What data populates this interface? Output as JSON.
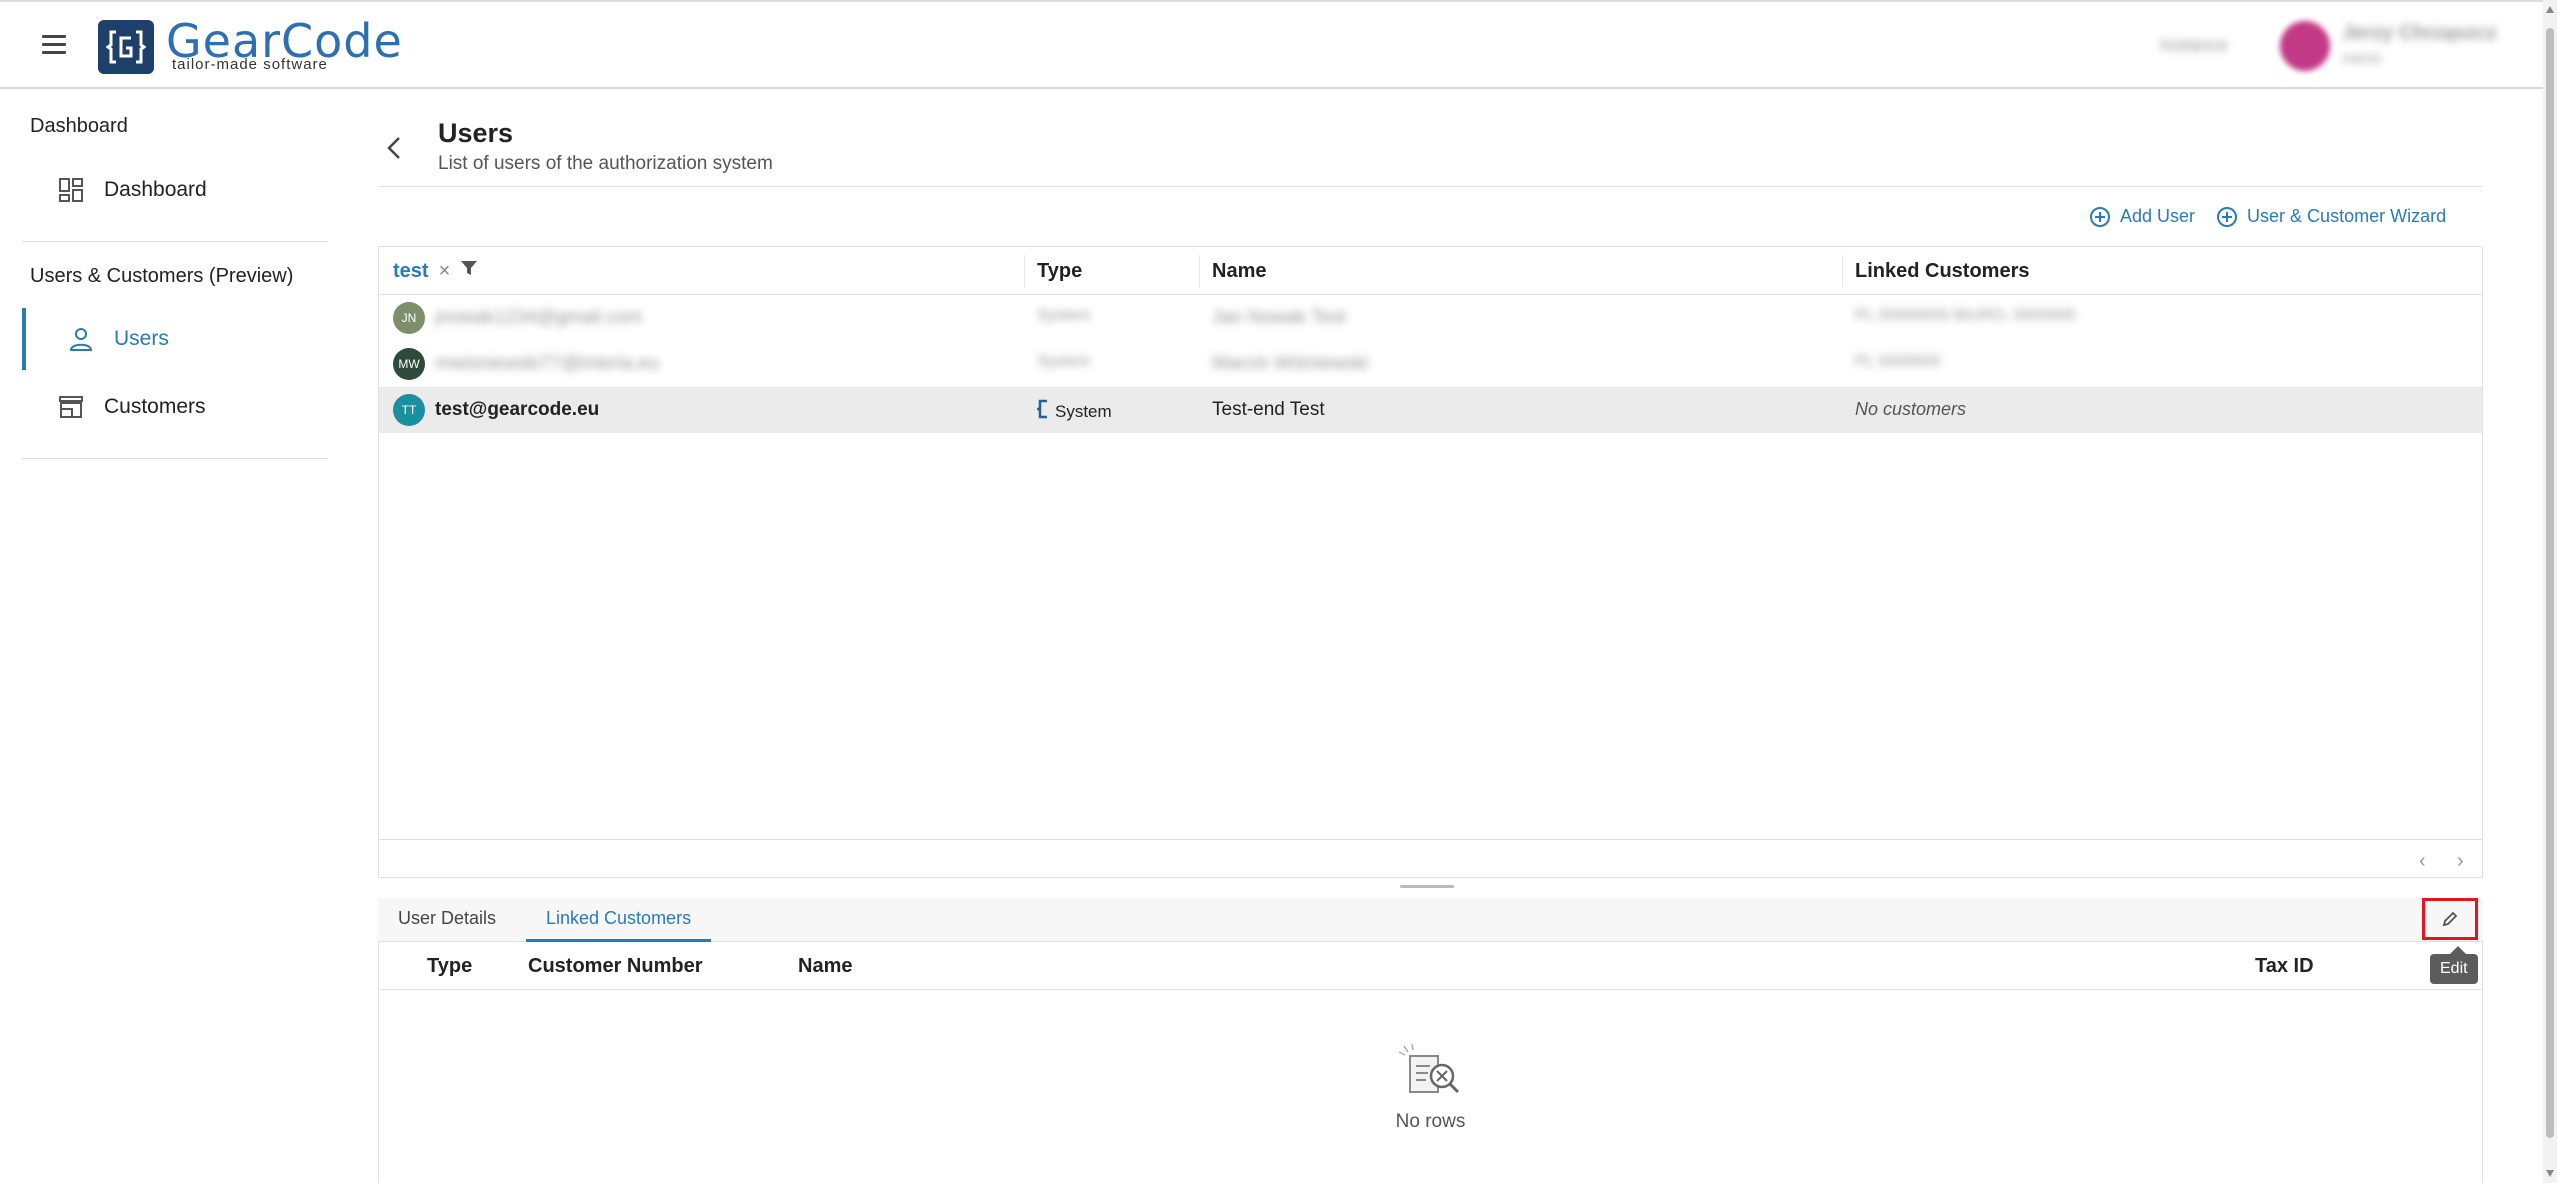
{
  "header": {
    "logo_text": "GearCode",
    "logo_sub": "tailor-made software",
    "status_text": "Instance",
    "user_name": "Jerzy Chrząszcz",
    "user_role": "Admin"
  },
  "sidebar": {
    "section1": "Dashboard",
    "dashboard_item": "Dashboard",
    "section2": "Users & Customers (Preview)",
    "users_item": "Users",
    "customers_item": "Customers"
  },
  "page": {
    "title": "Users",
    "subtitle": "List of users of the authorization system",
    "add_user": "Add User",
    "wizard": "User & Customer Wizard"
  },
  "grid": {
    "filter_value": "test",
    "columns": {
      "type": "Type",
      "name": "Name",
      "linked": "Linked Customers"
    },
    "rows": [
      {
        "initials": "JN",
        "email": "jnowak1234@gmail.com",
        "type": "System",
        "name": "Jan Nowak Test",
        "linked": "PL 00000000 BIURO, 0000000",
        "avatar_color": "#7d8f6a"
      },
      {
        "initials": "MW",
        "email": "mwisniewski77@interia.eu",
        "type": "System",
        "name": "Marcin Wiśniewski",
        "linked": "PL 0000000",
        "avatar_color": "#2e4a3a"
      },
      {
        "initials": "TT",
        "email": "test@gearcode.eu",
        "type": "System",
        "name": "Test-end Test",
        "linked": "No customers",
        "avatar_color": "#1a8fa0"
      }
    ]
  },
  "detail": {
    "tab_details": "User Details",
    "tab_linked": "Linked Customers",
    "edit_tooltip": "Edit",
    "columns": {
      "type": "Type",
      "customer_number": "Customer Number",
      "name": "Name",
      "tax_id": "Tax ID"
    },
    "empty_text": "No rows"
  },
  "colors": {
    "accent": "#2a7ab8",
    "highlight": "#e3161f",
    "brand_dark": "#1f3f6b"
  }
}
